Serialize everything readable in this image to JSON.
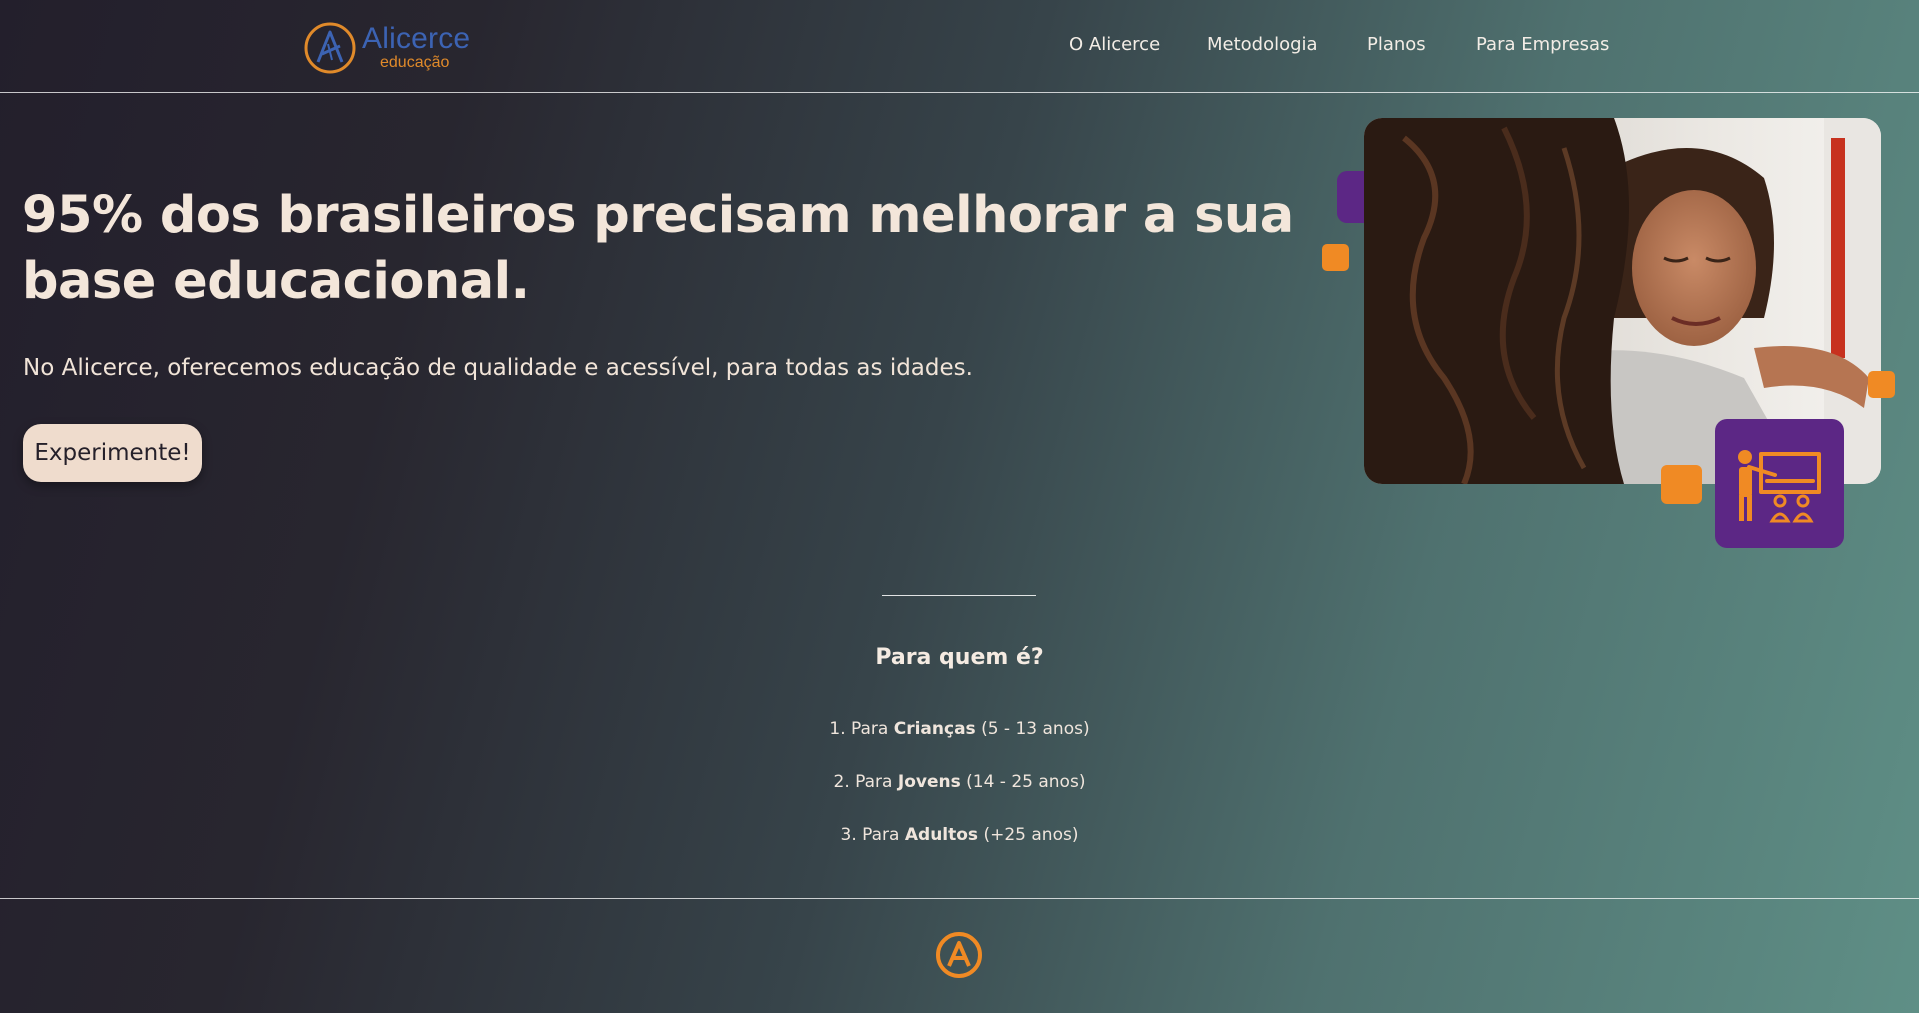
{
  "header": {
    "logo": {
      "name": "Alicerce",
      "sub": "educação",
      "brand_blue": "#3c63b3",
      "brand_orange": "#e08a2a"
    },
    "nav": [
      "O Alicerce",
      "Metodologia",
      "Planos",
      "Para Empresas"
    ]
  },
  "hero": {
    "title": "95% dos brasileiros precisam melhorar a sua base educacional.",
    "subtitle": "No Alicerce, oferecemos educação de qualidade e acessível, para todas as idades.",
    "cta": "Experimente!",
    "accent_purple": "#5c2785",
    "accent_orange": "#f08a24",
    "icons": [
      "teacher-presentation-icon"
    ]
  },
  "audience": {
    "title": "Para quem é?",
    "items": [
      {
        "prefix": "1. Para ",
        "group": "Crianças",
        "range": " (5 - 13 anos)"
      },
      {
        "prefix": "2. Para ",
        "group": "Jovens",
        "range": " (14 - 25 anos)"
      },
      {
        "prefix": "3. Para ",
        "group": "Adultos",
        "range": " (+25 anos)"
      }
    ]
  },
  "footer": {
    "icons": [
      "alicerce-logo-icon"
    ]
  }
}
